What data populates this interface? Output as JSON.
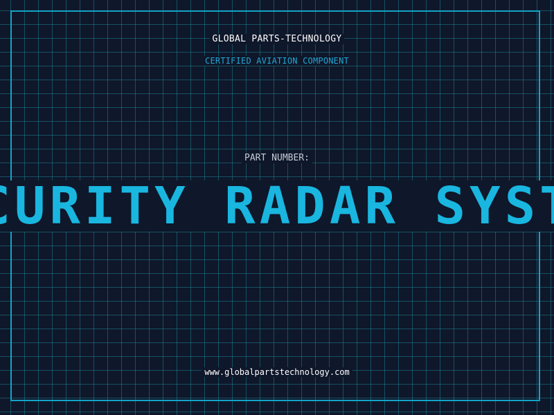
{
  "brand": {
    "name": "GLOBAL PARTS-TECHNOLOGY",
    "tagline": "CERTIFIED AVIATION COMPONENT"
  },
  "part": {
    "label": "PART NUMBER:",
    "number": "SECURITY RADAR SYSTEM"
  },
  "footer": {
    "url": "www.globalpartstechnology.com"
  },
  "colors": {
    "background": "#0f172a",
    "grid": "#1a8192",
    "accent": "#19b6e0",
    "text": "#ffffff"
  }
}
